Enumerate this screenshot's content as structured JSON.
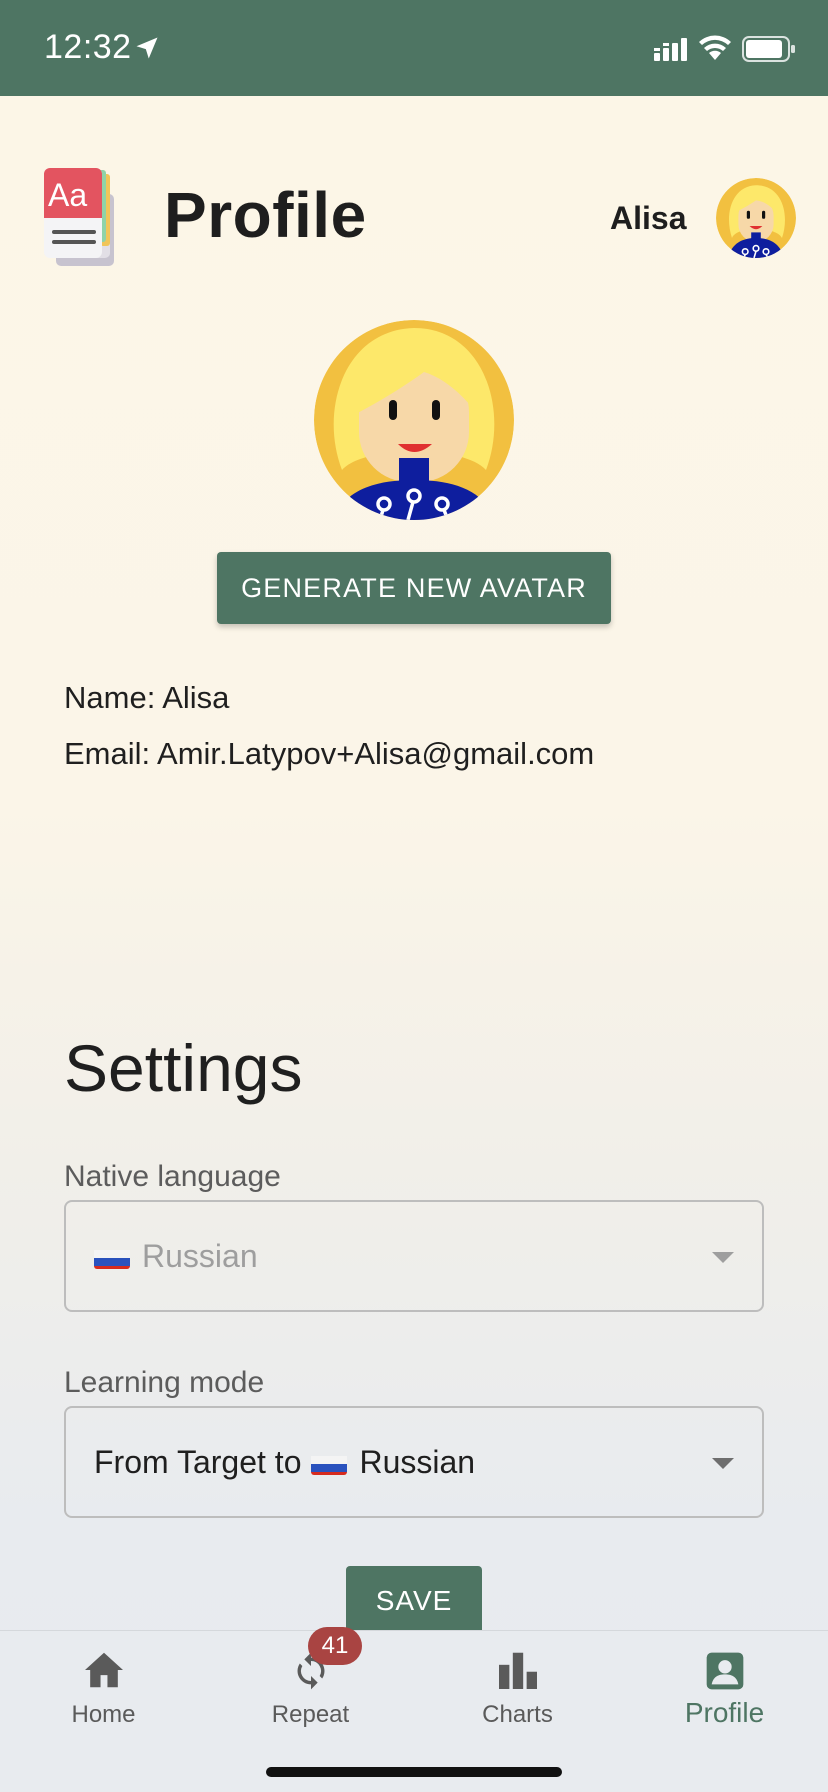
{
  "status_bar": {
    "time": "12:32"
  },
  "header": {
    "title": "Profile",
    "username": "Alisa"
  },
  "profile": {
    "generate_button": "GENERATE NEW AVATAR",
    "name_line": "Name: Alisa",
    "email_line": "Email: Amir.Latypov+Alisa@gmail.com"
  },
  "settings": {
    "heading": "Settings",
    "native_language": {
      "label": "Native language",
      "value": "Russian"
    },
    "learning_mode": {
      "label": "Learning mode",
      "value_prefix": "From Target to",
      "value": "Russian"
    },
    "save_button": "SAVE"
  },
  "bottom_nav": {
    "items": [
      {
        "label": "Home",
        "icon": "home-icon"
      },
      {
        "label": "Repeat",
        "icon": "sync-icon",
        "badge": "41"
      },
      {
        "label": "Charts",
        "icon": "bar-chart-icon"
      },
      {
        "label": "Profile",
        "icon": "account-box-icon",
        "active": true
      }
    ]
  },
  "colors": {
    "primary": "#4e7563",
    "badge": "#a94442",
    "background": "#fcf6e7"
  }
}
